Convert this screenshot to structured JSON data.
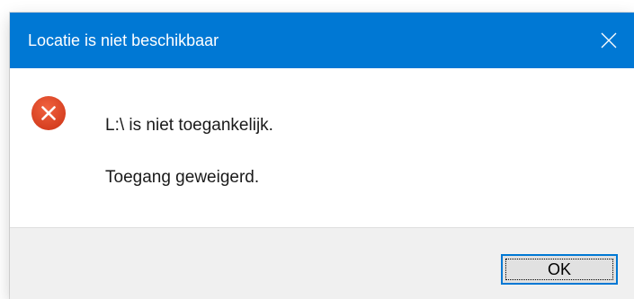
{
  "dialog": {
    "title": "Locatie is niet beschikbaar",
    "close_icon": "close-icon",
    "error_icon": "error-x-circle-icon",
    "message_line1": "L:\\ is niet toegankelijk.",
    "message_line2": "Toegang geweigerd.",
    "ok_label": "OK"
  },
  "colors": {
    "titlebar": "#0078d4",
    "error_icon": "#e0432b",
    "footer": "#f0f0f0",
    "button_border": "#0078d4"
  }
}
